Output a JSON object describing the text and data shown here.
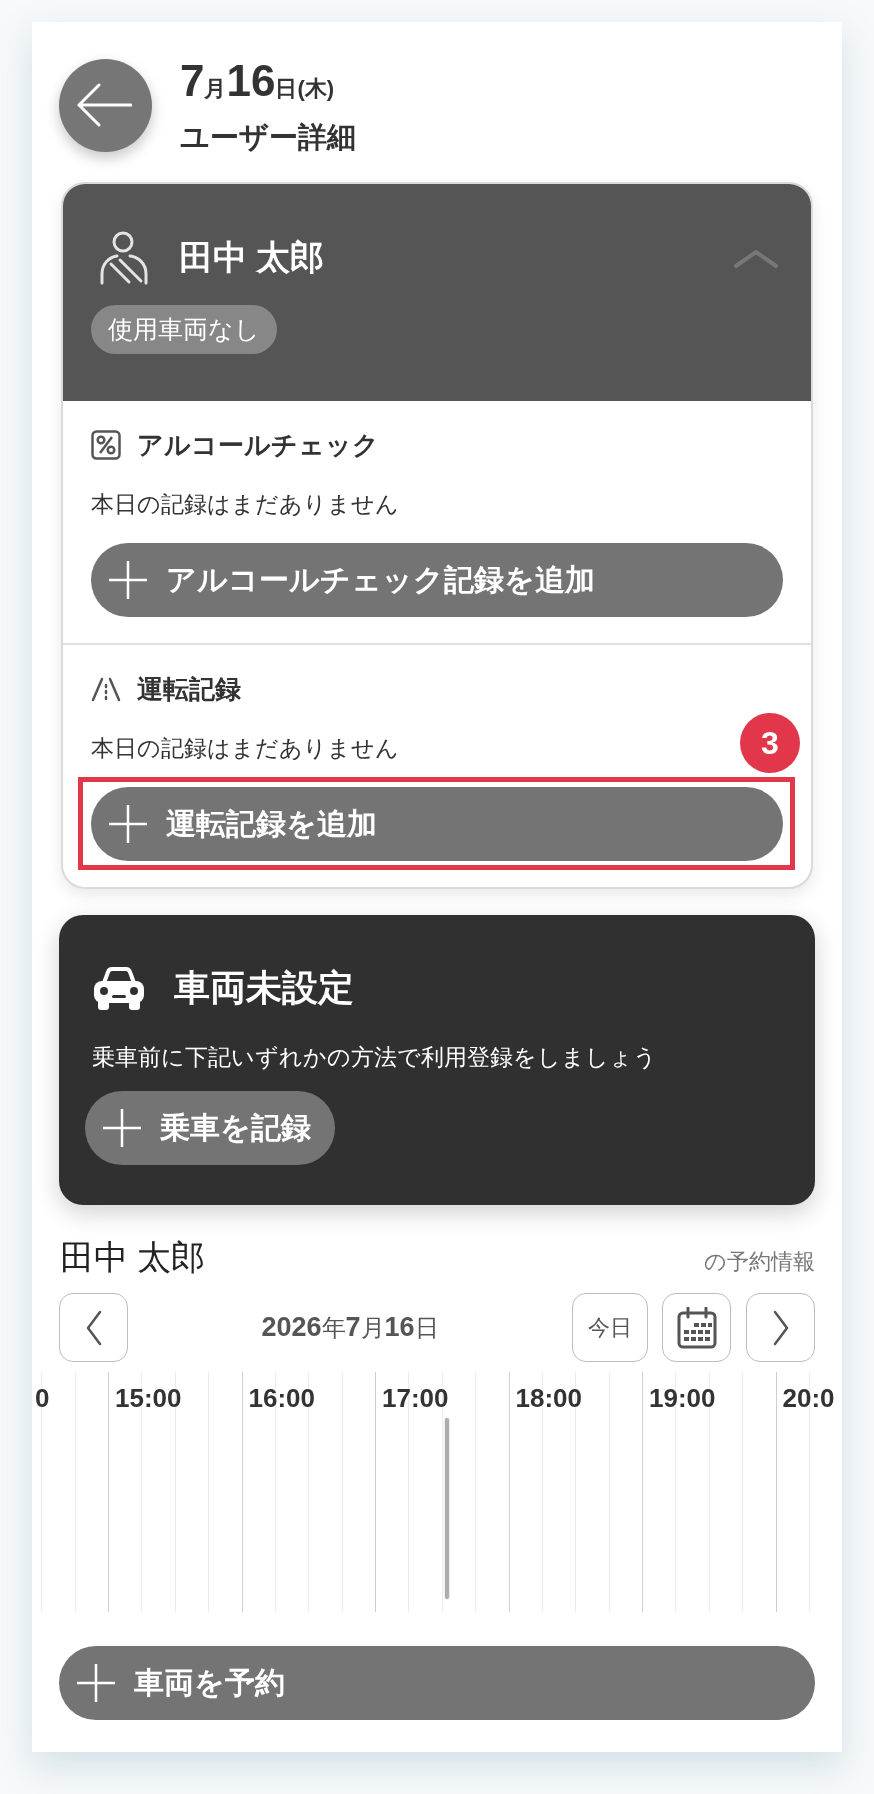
{
  "header": {
    "date": "7月16日(木)",
    "title": "ユーザー詳細"
  },
  "user_card": {
    "name": "田中 太郎",
    "expanded": true,
    "vehicle_badge": "使用車両なし",
    "sections": [
      {
        "kind": "alcohol",
        "title": "アルコールチェック",
        "message": "本日の記録はまだありません",
        "button": {
          "label": "アルコールチェック記録を追加"
        }
      },
      {
        "kind": "driving",
        "title": "運転記録",
        "message": "本日の記録はまだありません",
        "button": {
          "label": "運転記録を追加",
          "highlight": "3"
        }
      }
    ]
  },
  "vehicle_card": {
    "title": "車両未設定",
    "message": "乗車前に下記いずれかの方法で利用登録をしましょう",
    "button": {
      "label": "乗車を記録"
    }
  },
  "reservation": {
    "user": "田中 太郎",
    "caption": "の予約情報",
    "date": "2026年7月16日",
    "today_button": "今日",
    "timeline": {
      "hours": [
        "0",
        "15:00",
        "16:00",
        "17:00",
        "18:00",
        "19:00",
        "20:0"
      ],
      "now_marker": {
        "level": 0.51
      }
    },
    "button": {
      "label": "車両を予約"
    }
  }
}
